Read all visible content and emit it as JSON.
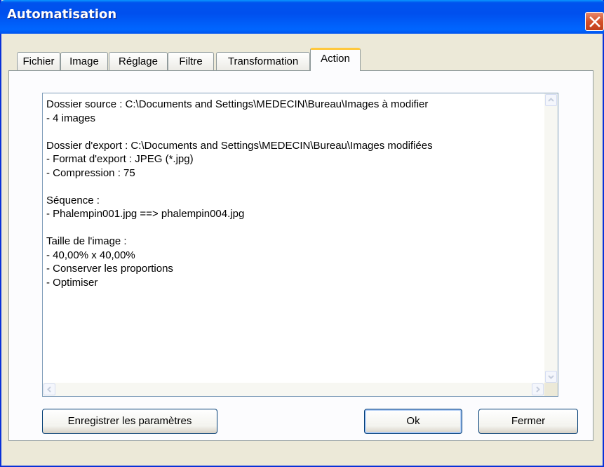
{
  "window": {
    "title": "Automatisation"
  },
  "tabs": [
    "Fichier",
    "Image",
    "Réglage",
    "Filtre",
    "Transformation",
    "Action"
  ],
  "active_tab": "Action",
  "summary_lines": [
    "Dossier source : C:\\Documents and Settings\\MEDECIN\\Bureau\\Images à modifier",
    "- 4 images",
    "",
    "Dossier d'export : C:\\Documents and Settings\\MEDECIN\\Bureau\\Images modifiées",
    "- Format d'export : JPEG (*.jpg)",
    "- Compression : 75",
    "",
    "Séquence :",
    "- Phalempin001.jpg ==> phalempin004.jpg",
    "",
    "Taille de l'image :",
    "- 40,00% x 40,00%",
    "- Conserver les proportions",
    "- Optimiser"
  ],
  "buttons": {
    "save_params": "Enregistrer les paramètres",
    "ok": "Ok",
    "close": "Fermer"
  }
}
